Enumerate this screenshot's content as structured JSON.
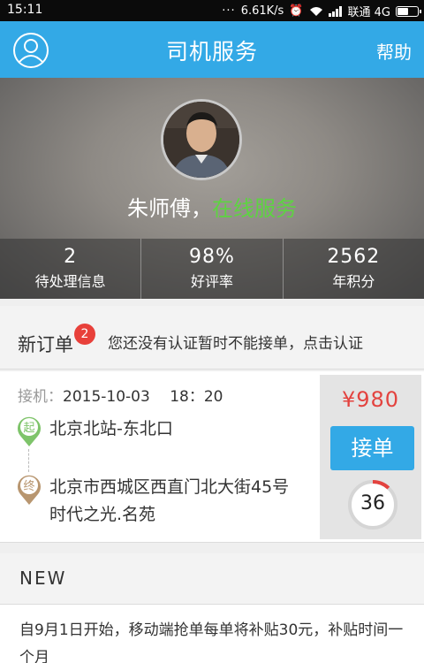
{
  "status_bar": {
    "time": "15:11",
    "speed": "6.61K/s",
    "carrier": "联通 4G"
  },
  "app_bar": {
    "title": "司机服务",
    "help": "帮助",
    "accent_color": "#33a9e6"
  },
  "profile": {
    "name": "朱师傅，",
    "status": "在线服务",
    "status_color": "#5ed342"
  },
  "stats": [
    {
      "value": "2",
      "label": "待处理信息"
    },
    {
      "value": "98%",
      "label": "好评率"
    },
    {
      "value": "2562",
      "label": "年积分"
    }
  ],
  "notice": {
    "label": "新订单",
    "badge": "2",
    "message": "您还没有认证暂时不能接单，点击认证"
  },
  "order": {
    "time_key": "接机：",
    "time_value": "2015-10-03　 18：20",
    "start_icon_label": "起",
    "end_icon_label": "终",
    "start_address": "北京北站-东北口",
    "end_address": "北京市西城区西直门北大街45号时代之光.名苑",
    "price": "¥980",
    "accept_label": "接单",
    "countdown": "36",
    "countdown_fraction": 0.12
  },
  "news": {
    "header": "NEW",
    "text": "自9月1日开始，移动端抢单每单将补贴30元，补贴时间一个月"
  }
}
